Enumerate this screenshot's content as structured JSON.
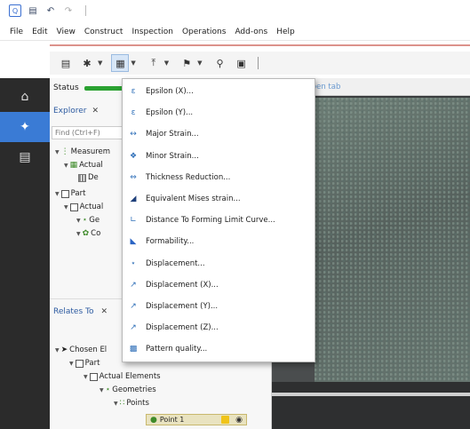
{
  "quick_access": {
    "icons": [
      "app-icon",
      "save-icon",
      "undo-icon",
      "redo-icon"
    ]
  },
  "menubar": {
    "items": [
      "File",
      "Edit",
      "View",
      "Construct",
      "Inspection",
      "Operations",
      "Add-ons",
      "Help"
    ]
  },
  "toolbar": {
    "buttons": [
      "align-icon",
      "gear-icon",
      "grid-icon",
      "upload-icon",
      "flag-icon",
      "search-icon",
      "camera-icon"
    ]
  },
  "leftnav": {
    "items": [
      "home-icon",
      "explorer-icon",
      "document-icon"
    ]
  },
  "panel": {
    "status_label": "Status",
    "explorer_tab": "Explorer",
    "find_placeholder": "Find (Ctrl+F)",
    "relates_tab": "Relates To",
    "tree_top": {
      "measurement": "Measurem",
      "actual": "Actual",
      "de": "De",
      "part": "Part",
      "actual2": "Actual",
      "ge": "Ge",
      "co": "Co"
    },
    "tree_bottom": {
      "chosen": "Chosen El",
      "part": "Part",
      "actual_elements": "Actual Elements",
      "geometries": "Geometries",
      "points": "Points",
      "point1": "Point 1"
    }
  },
  "content": {
    "open_tab": "Open tab"
  },
  "dropdown": {
    "items": [
      {
        "label": "Epsilon (X)...",
        "icon": "epsilon-x-icon"
      },
      {
        "label": "Epsilon (Y)...",
        "icon": "epsilon-y-icon"
      },
      {
        "label": "Major Strain...",
        "icon": "major-strain-icon"
      },
      {
        "label": "Minor Strain...",
        "icon": "minor-strain-icon"
      },
      {
        "label": "Thickness Reduction...",
        "icon": "thickness-reduction-icon"
      },
      {
        "label": "Equivalent Mises strain...",
        "icon": "mises-strain-icon"
      },
      {
        "label": "Distance To Forming Limit Curve...",
        "icon": "forming-limit-curve-icon"
      },
      {
        "label": "Formability...",
        "icon": "formability-icon"
      },
      {
        "label": "Displacement...",
        "icon": "displacement-icon"
      },
      {
        "label": "Displacement (X)...",
        "icon": "displacement-x-icon"
      },
      {
        "label": "Displacement (Y)...",
        "icon": "displacement-y-icon"
      },
      {
        "label": "Displacement (Z)...",
        "icon": "displacement-z-icon"
      },
      {
        "label": "Pattern quality...",
        "icon": "pattern-quality-icon"
      }
    ]
  },
  "colors": {
    "accent": "#3a7bd5",
    "status_green": "#2aa131",
    "nav_dark": "#2b2b2b"
  }
}
